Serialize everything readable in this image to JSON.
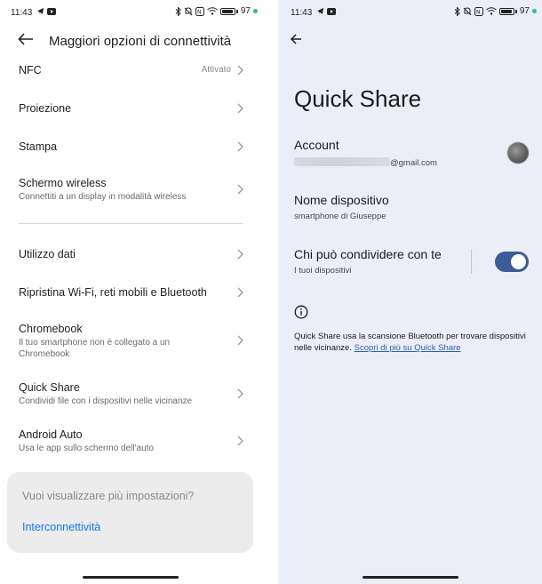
{
  "left": {
    "status": {
      "time": "11:43",
      "battery": "97"
    },
    "header": {
      "title": "Maggiori opzioni di connettività"
    },
    "items": [
      {
        "title": "NFC",
        "value": "Attivato"
      },
      {
        "title": "Proiezione"
      },
      {
        "title": "Stampa"
      },
      {
        "title": "Schermo wireless",
        "subtitle": "Connettiti a un display in modalità wireless"
      },
      {
        "title": "Utilizzo dati"
      },
      {
        "title": "Ripristina Wi-Fi, reti mobili e Bluetooth"
      },
      {
        "title": "Chromebook",
        "subtitle1": "Il tuo smartphone non è collegato a un",
        "subtitle2": "Chromebook"
      },
      {
        "title": "Quick Share",
        "subtitle": "Condividi file con i dispositivi nelle vicinanze"
      },
      {
        "title": "Android Auto",
        "subtitle": "Usa le app sullo schermo dell'auto"
      }
    ],
    "more": {
      "question": "Vuoi visualizzare più impostazioni?",
      "link": "Interconnettività"
    }
  },
  "right": {
    "status": {
      "time": "11:43",
      "battery": "97"
    },
    "title": "Quick Share",
    "account": {
      "label": "Account",
      "email_suffix": "@gmail.com"
    },
    "device": {
      "label": "Nome dispositivo",
      "value": "smartphone di Giuseppe"
    },
    "share": {
      "label": "Chi può condividere con te",
      "value": "I tuoi dispositivi",
      "enabled": true
    },
    "info": {
      "text": "Quick Share usa la scansione Bluetooth per trovare dispositivi nelle vicinanze. ",
      "link": "Scopri di più su Quick Share"
    }
  },
  "colors": {
    "accent_link": "#1677ff",
    "toggle_on": "#3d5a99",
    "right_bg": "#eceef7",
    "battery_dot": "#2ec27e"
  },
  "icons": [
    "back-arrow-icon",
    "chevron-right-icon",
    "telegram-icon",
    "youtube-icon",
    "bluetooth-icon",
    "mute-icon",
    "nfc-icon",
    "wifi-icon",
    "battery-icon",
    "info-icon"
  ]
}
